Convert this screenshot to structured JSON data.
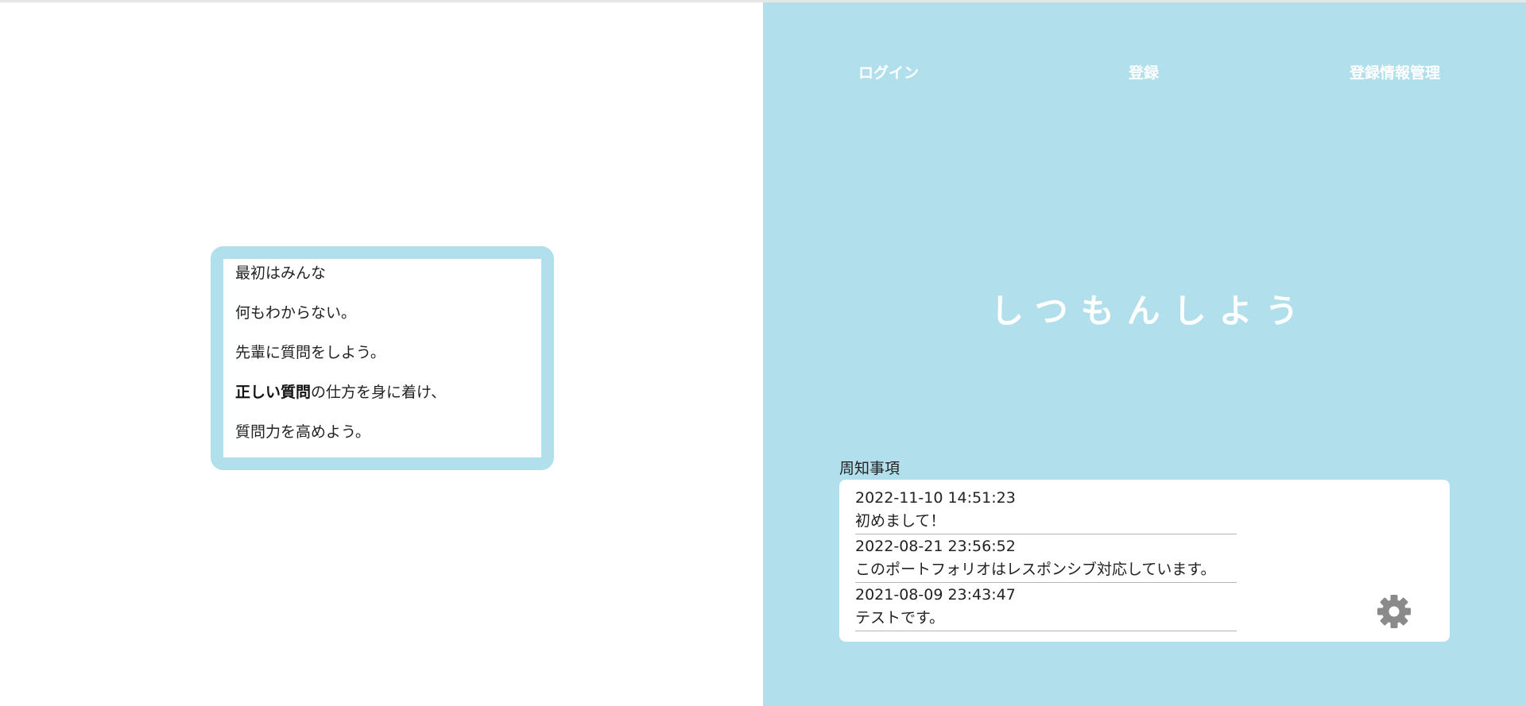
{
  "intro": {
    "lines": [
      "最初はみんな",
      "何もわからない。",
      "先輩に質問をしよう。",
      "の仕方を身に着け、",
      "質問力を高めよう。"
    ],
    "emphasis": "正しい質問"
  },
  "nav": {
    "login": "ログイン",
    "register": "登録",
    "account": "登録情報管理"
  },
  "hero": {
    "title": "しつもんしよう"
  },
  "notices": {
    "label": "周知事項",
    "items": [
      {
        "date": "2022-11-10 14:51:23",
        "text": "初めまして！"
      },
      {
        "date": "2022-08-21 23:56:52",
        "text": "このポートフォリオはレスポンシブ対応しています。"
      },
      {
        "date": "2021-08-09 23:43:47",
        "text": "テストです。"
      }
    ],
    "settings_icon": "gear-icon"
  },
  "colors": {
    "accent": "#b1dfec",
    "panel": "#ffffff",
    "gear": "#8a8a8a"
  }
}
